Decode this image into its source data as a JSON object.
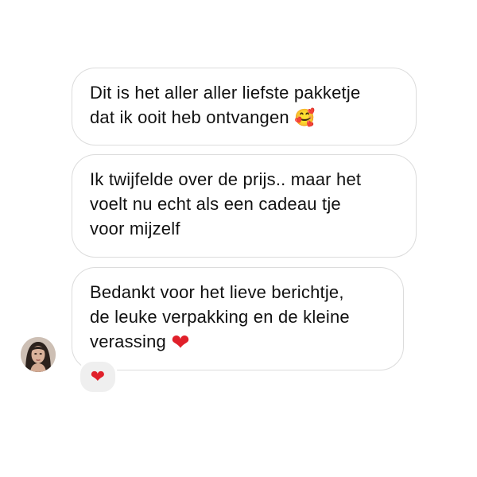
{
  "messages": [
    {
      "lines": [
        "Dit is het aller aller liefste pakketje",
        "dat ik ooit heb ontvangen"
      ],
      "emoji": "🥰"
    },
    {
      "lines": [
        "Ik twijfelde over de prijs.. maar het",
        "voelt nu echt als een cadeau tje",
        "voor mijzelf"
      ]
    },
    {
      "lines": [
        "Bedankt voor het lieve berichtje,",
        "de leuke verpakking en de kleine",
        "verassing"
      ],
      "emoji": "❤"
    }
  ],
  "reaction": {
    "emoji": "❤"
  },
  "colors": {
    "bubble_border": "#dcdcdc",
    "reaction_bg": "#efefef",
    "heart": "#e0202a"
  },
  "icons": {
    "avatar": "profile-photo-avatar",
    "reaction": "heart-icon"
  }
}
